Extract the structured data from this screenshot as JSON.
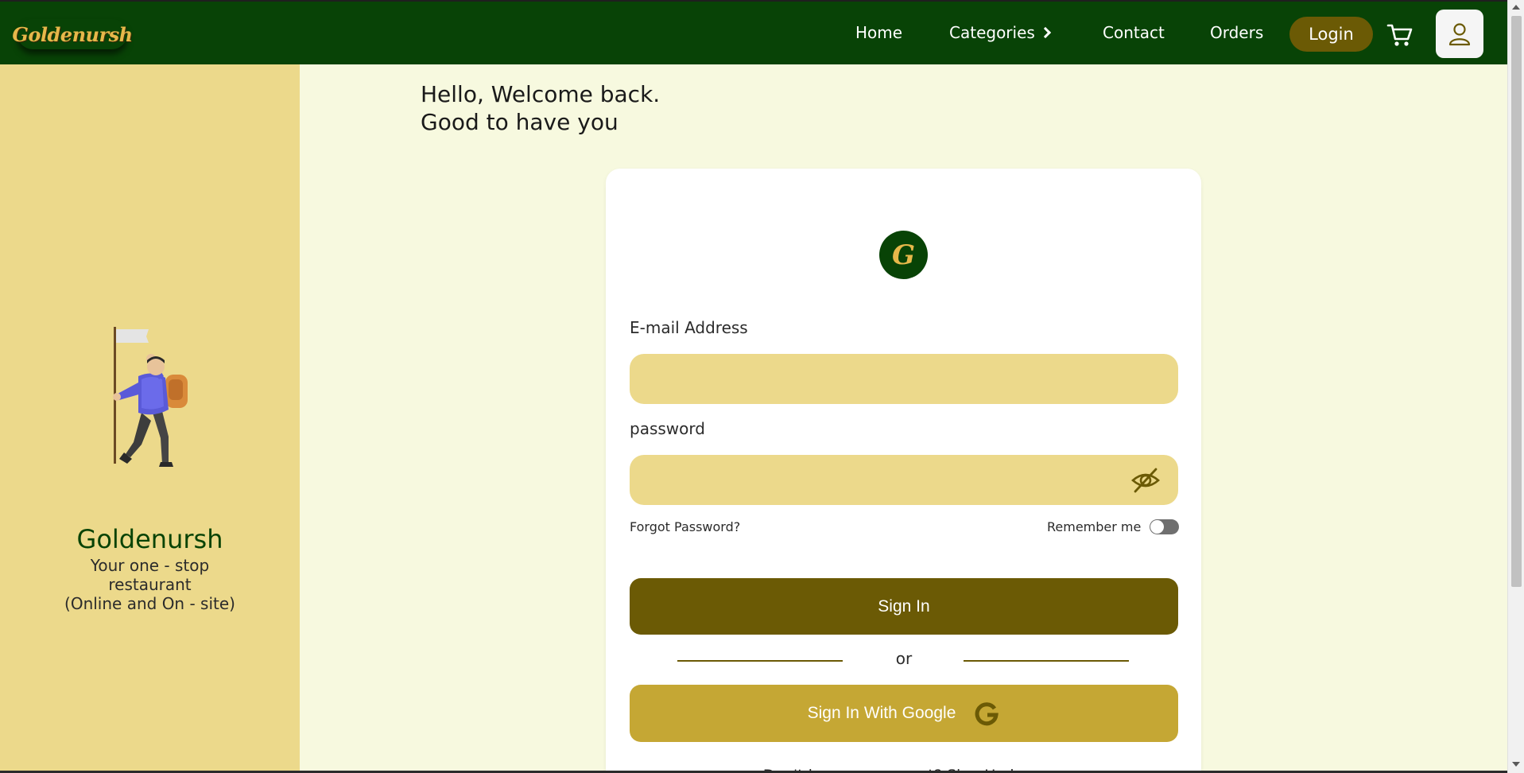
{
  "nav": {
    "brand": "Goldenursh",
    "home": "Home",
    "categories": "Categories",
    "contact": "Contact",
    "orders": "Orders",
    "login": "Login"
  },
  "sidebar": {
    "title": "Goldenursh",
    "subtitle_line1": "Your one - stop",
    "subtitle_line2": "restaurant",
    "subtitle_line3": "(Online and On - site)"
  },
  "greeting": {
    "line1": "Hello, Welcome back.",
    "line2": "Good to have you"
  },
  "form": {
    "logo_letter": "G",
    "email_label": "E-mail Address",
    "email_value": "",
    "password_label": "password",
    "password_value": "",
    "forgot": "Forgot Password?",
    "remember": "Remember me",
    "remember_on": false,
    "signin": "Sign In",
    "or": "or",
    "google": "Sign In With Google",
    "signup_prompt": "Don't have an account? Sign Up here"
  },
  "icons": {
    "cart": "cart-icon",
    "profile": "user-icon",
    "eye": "eye-off-icon",
    "google": "google-icon",
    "chevron": "chevron-right-icon"
  },
  "colors": {
    "nav_bg": "#084306",
    "accent_gold": "#e6b84a",
    "login_bg": "#6b5a05",
    "sidebar_bg": "#ecd98b",
    "page_bg": "#f7f9df",
    "input_bg": "#ecd98b",
    "signin_bg": "#6b5a05",
    "google_bg": "#c5a734"
  }
}
